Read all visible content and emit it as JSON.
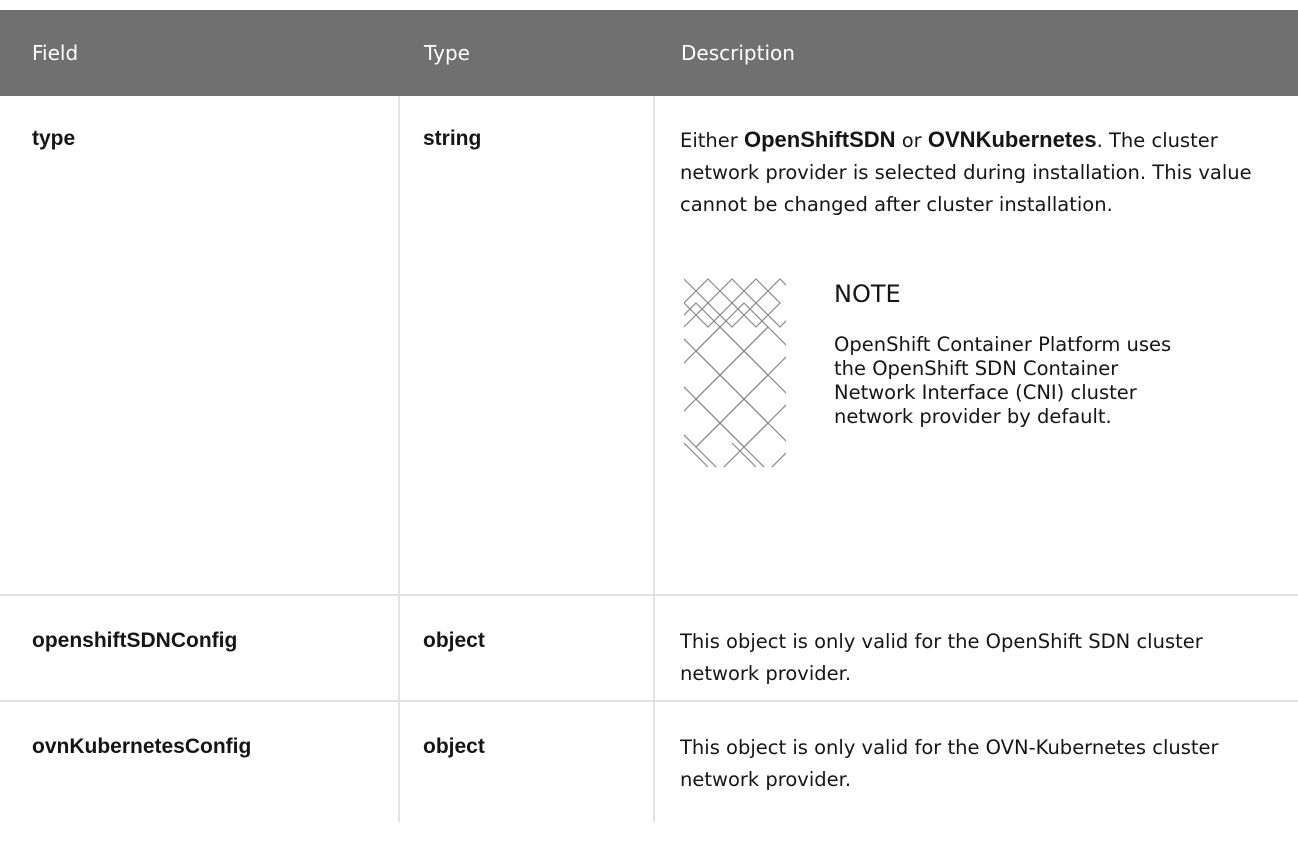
{
  "headers": {
    "field": "Field",
    "type": "Type",
    "description": "Description"
  },
  "rows": [
    {
      "field": "type",
      "type": "string",
      "description": {
        "prefix": "Either ",
        "bold1": "OpenShiftSDN",
        "middle": " or ",
        "bold2": "OVNKubernetes",
        "suffix": ". The cluster network provider is selected during installation. This value cannot be changed after cluster installation."
      },
      "note": {
        "title": "NOTE",
        "text": "OpenShift Container Platform uses the OpenShift SDN Container Network Interface (CNI) cluster network provider by default.",
        "icon": "note-pattern-icon"
      }
    },
    {
      "field": "openshiftSDNConfig",
      "type": "object",
      "description": "This object is only valid for the OpenShift SDN cluster network provider."
    },
    {
      "field": "ovnKubernetesConfig",
      "type": "object",
      "description": "This object is only valid for the OVN-Kubernetes cluster network provider."
    }
  ]
}
